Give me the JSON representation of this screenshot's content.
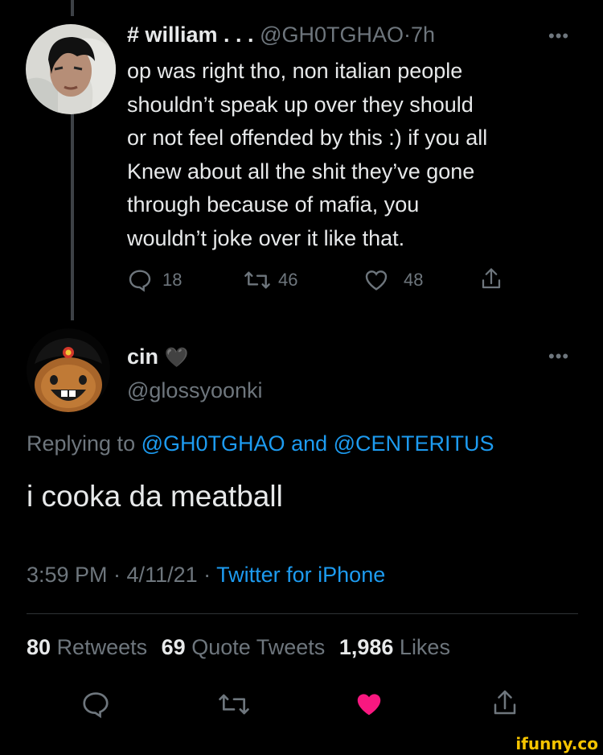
{
  "tweet1": {
    "display_name": "# william . . .",
    "handle": "@GH0TGHAO",
    "sep": "·",
    "time": "7h",
    "lines": [
      "op was right tho, non italian people",
      "shouldn’t speak up over they should",
      "or not feel offended by this :) if you all",
      "Knew about all the shit they’ve gone",
      "through because of mafia, you",
      "wouldn’t joke over it like that."
    ],
    "replies": "18",
    "retweets": "46",
    "likes": "48",
    "more_label": "•••"
  },
  "tweet2": {
    "display_name": "cin",
    "heart_emoji": "🖤",
    "handle": "@glossyoonki",
    "more_label": "•••",
    "replying_prefix": "Replying to",
    "reply_to_1": "@GH0TGHAO",
    "and_word": "and",
    "reply_to_2": "@CENTERITUS",
    "text": "i cooka da meatball",
    "timestamp": "3:59 PM · 4/11/21 ·",
    "source": "Twitter for iPhone",
    "retweets_count": "80",
    "retweets_label": "Retweets",
    "quotes_count": "69",
    "quotes_label": "Quote Tweets",
    "likes_count": "1,986",
    "likes_label": "Likes"
  },
  "colors": {
    "background": "#000000",
    "text": "#e7e9ea",
    "muted": "#6e767d",
    "link": "#1d9bf0",
    "like_active": "#f91880"
  },
  "icons": [
    "reply-icon",
    "retweet-icon",
    "like-icon",
    "share-icon",
    "more-icon"
  ],
  "watermark": "ifunny.co"
}
